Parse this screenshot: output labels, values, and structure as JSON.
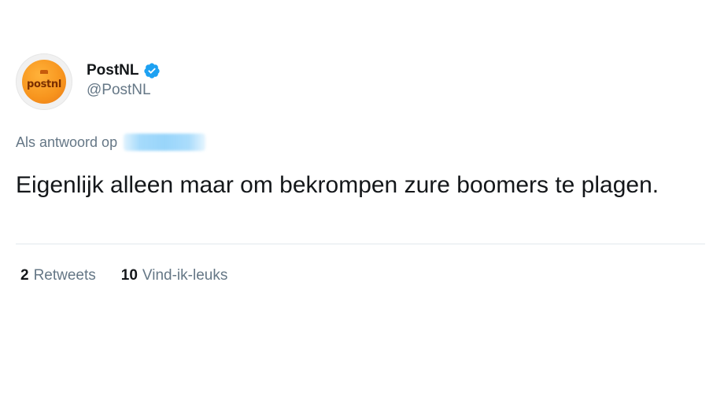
{
  "author": {
    "display_name": "PostNL",
    "handle": "@PostNL",
    "verified": true,
    "avatar_wordmark": "postnl",
    "brand_color": "#f7941d"
  },
  "reply": {
    "label": "Als antwoord op"
  },
  "tweet": {
    "text": "Eigenlijk alleen maar om bekrompen zure boomers te plagen."
  },
  "stats": {
    "retweets": {
      "count": "2",
      "label": "Retweets"
    },
    "likes": {
      "count": "10",
      "label": "Vind-ik-leuks"
    }
  },
  "colors": {
    "text_primary": "#14171a",
    "text_secondary": "#657786",
    "verified_blue": "#1da1f2",
    "divider": "#e1e8ed"
  }
}
